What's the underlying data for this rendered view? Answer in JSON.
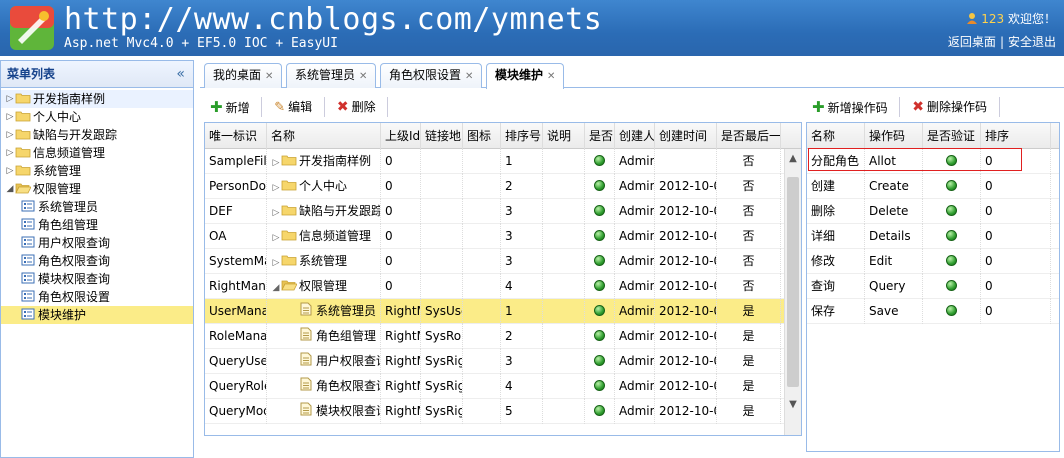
{
  "header": {
    "url": "http://www.cnblogs.com/ymnets",
    "subtitle": "Asp.net Mvc4.0 + EF5.0 IOC + EasyUI",
    "user_name": "123",
    "welcome": "欢迎您！",
    "link_home": "返回桌面",
    "link_logout": "安全退出"
  },
  "menu": {
    "title": "菜单列表",
    "collapse": "«",
    "items": [
      {
        "label": "开发指南样例",
        "type": "folder",
        "level": 0
      },
      {
        "label": "个人中心",
        "type": "folder",
        "level": 0
      },
      {
        "label": "缺陷与开发跟踪",
        "type": "folder",
        "level": 0
      },
      {
        "label": "信息频道管理",
        "type": "folder",
        "level": 0
      },
      {
        "label": "系统管理",
        "type": "folder",
        "level": 0
      },
      {
        "label": "权限管理",
        "type": "folder-open",
        "level": 0
      },
      {
        "label": "系统管理员",
        "type": "page",
        "level": 1
      },
      {
        "label": "角色组管理",
        "type": "page",
        "level": 1
      },
      {
        "label": "用户权限查询",
        "type": "page",
        "level": 1
      },
      {
        "label": "角色权限查询",
        "type": "page",
        "level": 1
      },
      {
        "label": "模块权限查询",
        "type": "page",
        "level": 1
      },
      {
        "label": "角色权限设置",
        "type": "page",
        "level": 1
      },
      {
        "label": "模块维护",
        "type": "page",
        "level": 1
      }
    ]
  },
  "tabs": [
    {
      "label": "我的桌面"
    },
    {
      "label": "系统管理员"
    },
    {
      "label": "角色权限设置"
    },
    {
      "label": "模块维护"
    }
  ],
  "toolbar_left": {
    "add": "新增",
    "edit": "编辑",
    "delete": "删除"
  },
  "toolbar_right": {
    "add": "新增操作码",
    "delete": "删除操作码"
  },
  "module_grid": {
    "headers": [
      "唯一标识",
      "名称",
      "上级Id",
      "链接地",
      "图标",
      "排序号",
      "说明",
      "是否",
      "创建人",
      "创建时间",
      "是否最后一"
    ],
    "rows": [
      {
        "id": "SampleFile",
        "name": "开发指南样例",
        "parent": "0",
        "url": "",
        "icon": "",
        "sort": "1",
        "desc": "",
        "enabled": true,
        "creator": "Admin",
        "created": "",
        "last": "否"
      },
      {
        "id": "PersonDoc",
        "name": "个人中心",
        "parent": "0",
        "url": "",
        "icon": "",
        "sort": "2",
        "desc": "",
        "enabled": true,
        "creator": "Admin",
        "created": "2012-10-0",
        "last": "否"
      },
      {
        "id": "DEF",
        "name": "缺陷与开发跟踪",
        "parent": "0",
        "url": "",
        "icon": "",
        "sort": "3",
        "desc": "",
        "enabled": true,
        "creator": "Admin",
        "created": "2012-10-0",
        "last": "否"
      },
      {
        "id": "OA",
        "name": "信息频道管理",
        "parent": "0",
        "url": "",
        "icon": "",
        "sort": "3",
        "desc": "",
        "enabled": true,
        "creator": "Admin",
        "created": "2012-10-0",
        "last": "否"
      },
      {
        "id": "SystemManage",
        "name": "系统管理",
        "parent": "0",
        "url": "",
        "icon": "",
        "sort": "3",
        "desc": "",
        "enabled": true,
        "creator": "Admin",
        "created": "2012-10-0",
        "last": "否"
      },
      {
        "id": "RightManage",
        "name": "权限管理",
        "parent": "0",
        "url": "",
        "icon": "",
        "sort": "4",
        "desc": "",
        "enabled": true,
        "creator": "Admin",
        "created": "2012-10-0",
        "last": "否"
      },
      {
        "id": "UserManage",
        "name": "系统管理员",
        "parent": "RightM",
        "url": "SysUse",
        "icon": "",
        "sort": "1",
        "desc": "",
        "enabled": true,
        "creator": "Admin",
        "created": "2012-10-0",
        "last": "是"
      },
      {
        "id": "RoleManage",
        "name": "角色组管理",
        "parent": "RightM",
        "url": "SysRol",
        "icon": "",
        "sort": "2",
        "desc": "",
        "enabled": true,
        "creator": "Admin",
        "created": "2012-10-0",
        "last": "是"
      },
      {
        "id": "QueryUser",
        "name": "用户权限查询",
        "parent": "RightM",
        "url": "SysRig",
        "icon": "",
        "sort": "3",
        "desc": "",
        "enabled": true,
        "creator": "Admin",
        "created": "2012-10-0",
        "last": "是"
      },
      {
        "id": "QueryRole",
        "name": "角色权限查询",
        "parent": "RightM",
        "url": "SysRig",
        "icon": "",
        "sort": "4",
        "desc": "",
        "enabled": true,
        "creator": "Admin",
        "created": "2012-10-0",
        "last": "是"
      },
      {
        "id": "QueryModule",
        "name": "模块权限查询",
        "parent": "RightM",
        "url": "SysRig",
        "icon": "",
        "sort": "5",
        "desc": "",
        "enabled": true,
        "creator": "Admin",
        "created": "2012-10-0",
        "last": "是"
      }
    ]
  },
  "op_grid": {
    "headers": [
      "名称",
      "操作码",
      "是否验证",
      "排序"
    ],
    "rows": [
      {
        "name": "分配角色",
        "code": "Allot",
        "verify": true,
        "sort": "0"
      },
      {
        "name": "创建",
        "code": "Create",
        "verify": true,
        "sort": "0"
      },
      {
        "name": "删除",
        "code": "Delete",
        "verify": true,
        "sort": "0"
      },
      {
        "name": "详细",
        "code": "Details",
        "verify": true,
        "sort": "0"
      },
      {
        "name": "修改",
        "code": "Edit",
        "verify": true,
        "sort": "0"
      },
      {
        "name": "查询",
        "code": "Query",
        "verify": true,
        "sort": "0"
      },
      {
        "name": "保存",
        "code": "Save",
        "verify": true,
        "sort": "0"
      }
    ]
  }
}
